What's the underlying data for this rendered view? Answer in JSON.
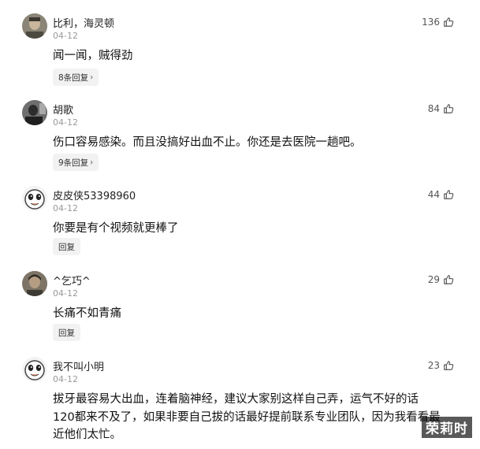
{
  "comments": [
    {
      "username": "比利，海灵顿",
      "date": "04-12",
      "text": "闻一闻，贼得劲",
      "likes": "136",
      "reply_label": "8条回复",
      "reply_has_chevron": true,
      "avatar": "man-photo"
    },
    {
      "username": "胡歌",
      "date": "04-12",
      "text": "伤口容易感染。而且没搞好出血不止。你还是去医院一趟吧。",
      "likes": "84",
      "reply_label": "9条回复",
      "reply_has_chevron": true,
      "avatar": "person-photo"
    },
    {
      "username": "皮皮侠53398960",
      "date": "04-12",
      "text": "你要是有个视频就更棒了",
      "likes": "44",
      "reply_label": "回复",
      "reply_has_chevron": false,
      "avatar": "cartoon-face"
    },
    {
      "username": "^乞巧^",
      "date": "04-12",
      "text": "长痛不如青痛",
      "likes": "29",
      "reply_label": "回复",
      "reply_has_chevron": false,
      "avatar": "portrait-photo"
    },
    {
      "username": "我不叫小明",
      "date": "04-12",
      "text_lines": [
        "拔牙最容易大出血，连着脑神经，建议大家别这样自己弄，运气不好的话",
        "120都来不及了，如果非要自己拔的话最好提前联系专业团队，因为我看看最",
        "近他们太忙。"
      ],
      "likes": "23",
      "avatar": "cartoon-face"
    }
  ],
  "watermark": "荣莉时"
}
